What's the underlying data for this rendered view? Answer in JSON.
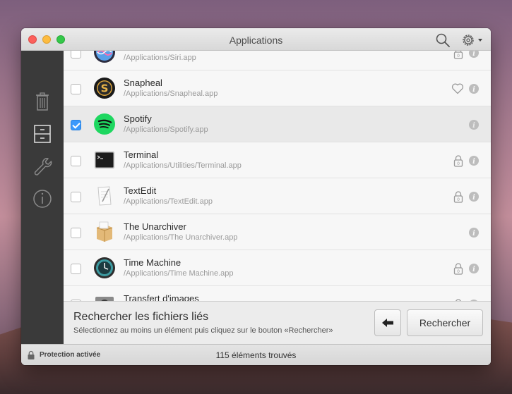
{
  "window": {
    "title": "Applications"
  },
  "rows": [
    {
      "name": "",
      "path": "/Applications/Siri.app",
      "checked": false,
      "badge": "lock"
    },
    {
      "name": "Snapheal",
      "path": "/Applications/Snapheal.app",
      "checked": false,
      "badge": "heart"
    },
    {
      "name": "Spotify",
      "path": "/Applications/Spotify.app",
      "checked": true,
      "badge": "none"
    },
    {
      "name": "Terminal",
      "path": "/Applications/Utilities/Terminal.app",
      "checked": false,
      "badge": "lock"
    },
    {
      "name": "TextEdit",
      "path": "/Applications/TextEdit.app",
      "checked": false,
      "badge": "lock"
    },
    {
      "name": "The Unarchiver",
      "path": "/Applications/The Unarchiver.app",
      "checked": false,
      "badge": "none"
    },
    {
      "name": "Time Machine",
      "path": "/Applications/Time Machine.app",
      "checked": false,
      "badge": "lock"
    },
    {
      "name": "Transfert d'images",
      "path": "",
      "checked": false,
      "badge": "lock"
    }
  ],
  "bottom": {
    "title": "Rechercher les fichiers liés",
    "subtitle": "Sélectionnez au moins un élément puis cliquez sur le bouton «Rechercher»",
    "search_label": "Rechercher"
  },
  "status": {
    "protection": "Protection activée",
    "count": "115 éléments trouvés"
  },
  "colors": {
    "accent": "#3b99fc",
    "sidebar": "#3a3a3a",
    "spotify": "#1ed760"
  }
}
